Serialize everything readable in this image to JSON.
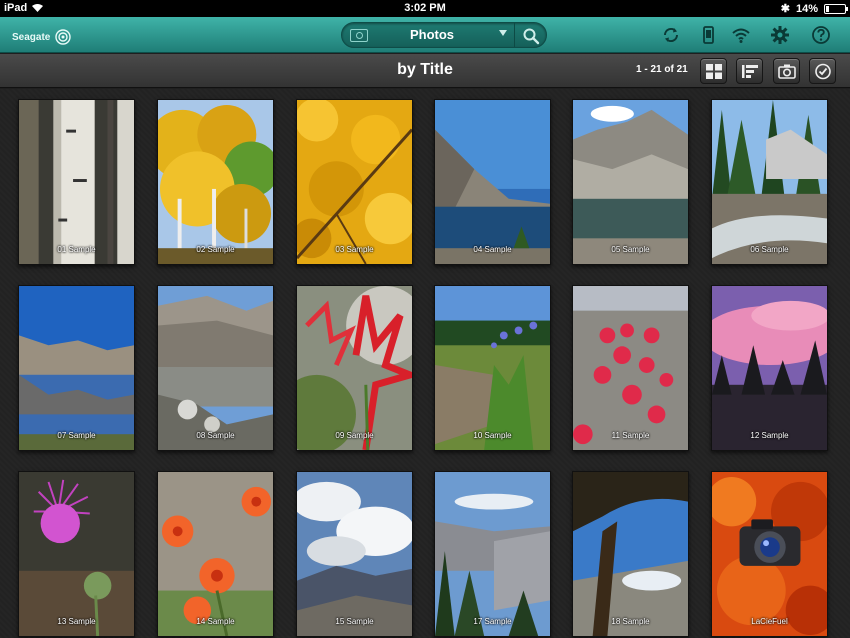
{
  "status": {
    "device": "iPad",
    "time": "3:02 PM",
    "battery": "14%",
    "battery_level": 0.14
  },
  "app": {
    "brand": "Seagate",
    "source_label": "Photos"
  },
  "subbar": {
    "title": "by Title",
    "count": "1 - 21 of 21"
  },
  "icons": {
    "sync": "sync-icon",
    "device": "phone-icon",
    "wifi": "wifi-icon",
    "settings": "gear-icon",
    "help": "help-icon"
  },
  "colors": {
    "accent": "#2a9d93",
    "bar": "#333333"
  },
  "photos": [
    {
      "label": "01 Sample",
      "theme": "birch"
    },
    {
      "label": "02 Sample",
      "theme": "aspen"
    },
    {
      "label": "03 Sample",
      "theme": "leaves"
    },
    {
      "label": "04 Sample",
      "theme": "lake"
    },
    {
      "label": "05 Sample",
      "theme": "mountain-lake"
    },
    {
      "label": "06 Sample",
      "theme": "stream"
    },
    {
      "label": "07 Sample",
      "theme": "reflect"
    },
    {
      "label": "08 Sample",
      "theme": "granite-lake"
    },
    {
      "label": "09 Sample",
      "theme": "paintbrush"
    },
    {
      "label": "10 Sample",
      "theme": "lupine"
    },
    {
      "label": "11 Sample",
      "theme": "red-flowers"
    },
    {
      "label": "12 Sample",
      "theme": "sunset"
    },
    {
      "label": "13 Sample",
      "theme": "thistle"
    },
    {
      "label": "14 Sample",
      "theme": "lily"
    },
    {
      "label": "15 Sample",
      "theme": "clouds"
    },
    {
      "label": "17 Sample",
      "theme": "valley"
    },
    {
      "label": "18 Sample",
      "theme": "tree"
    },
    {
      "label": "LaCieFuel",
      "theme": "camera"
    }
  ]
}
